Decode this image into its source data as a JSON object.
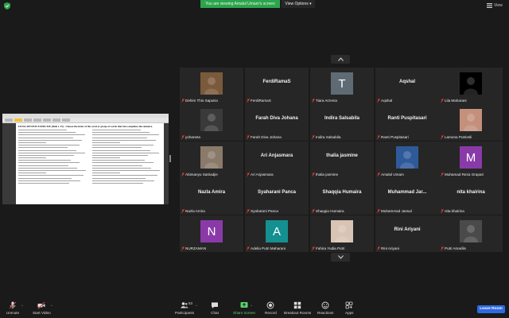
{
  "topbar": {
    "shield_color": "#2da44e",
    "viewing_text": "You are viewing Amalul Umam's screen",
    "view_options": "View Options",
    "view_toggle": "View"
  },
  "shared_screen": {
    "doc_heading": "FINAL REVIEW EXERCISE (Rule 1-15) - Choose the letter of the word or group of words that best completes the sentence."
  },
  "gallery": {
    "rows": [
      [
        {
          "name": "Dehim Thio Saputra",
          "kind": "photo",
          "color": "#7a5a3a"
        },
        {
          "name": "FerdiRamaS",
          "kind": "name"
        },
        {
          "name": "Tiara Arzenia",
          "kind": "letter",
          "letter": "T",
          "color": "#5f6b74"
        },
        {
          "name": "Aqshal",
          "kind": "name"
        },
        {
          "name": "Lila Maharani",
          "kind": "photo",
          "color": "#000000"
        }
      ],
      [
        {
          "name": "yohaneta",
          "kind": "photo",
          "color": "#3a3a3a"
        },
        {
          "name": "Farah Diva Johana",
          "kind": "name"
        },
        {
          "name": "Indira Salsabila",
          "kind": "name"
        },
        {
          "name": "Ranti Puspitasari",
          "kind": "name"
        },
        {
          "name": "Lamona Putriesli",
          "kind": "photo",
          "color": "#c4907c"
        }
      ],
      [
        {
          "name": "Abimanyu Satriadjie",
          "kind": "photo",
          "color": "#8a7a6a"
        },
        {
          "name": "Ari Anjasmara",
          "kind": "name"
        },
        {
          "name": "thalia jasmine",
          "kind": "name"
        },
        {
          "name": "Amalul Umam",
          "kind": "photo",
          "color": "#2f5a9a"
        },
        {
          "name": "Muhamad Reza Grapari",
          "kind": "letter",
          "letter": "M",
          "color": "#8a3aa8"
        }
      ],
      [
        {
          "name": "Nazla Amira",
          "kind": "name"
        },
        {
          "name": "Syaharani Panca",
          "kind": "name"
        },
        {
          "name": "Shaqqia Humaira",
          "kind": "name"
        },
        {
          "name": "Muhammad Jarwal",
          "kind": "name",
          "display": "Muhammad Jar..."
        },
        {
          "name": "nita khairina",
          "kind": "name"
        }
      ],
      [
        {
          "name": "NURZAMAN",
          "kind": "letter",
          "letter": "N",
          "color": "#8a3aa8"
        },
        {
          "name": "Adelia Putri Maharani",
          "kind": "letter",
          "letter": "A",
          "color": "#159090"
        },
        {
          "name": "Fahira Yudia Putri",
          "kind": "photo",
          "color": "#d8c4b4"
        },
        {
          "name": "Rini Ariyani",
          "kind": "name"
        },
        {
          "name": "Putri Amarilis",
          "kind": "photo",
          "color": "#4a4a4a"
        }
      ]
    ]
  },
  "toolbar": {
    "unmute": "Unmute",
    "start_video": "Start Video",
    "participants": "Participants",
    "participants_count": "53",
    "chat": "Chat",
    "share_screen": "Share Screen",
    "record": "Record",
    "breakout_rooms": "Breakout Rooms",
    "reactions": "Reactions",
    "apps": "Apps",
    "leave": "Leave Room",
    "share_color": "#5bd36a",
    "leave_color": "#2d6ae3"
  }
}
